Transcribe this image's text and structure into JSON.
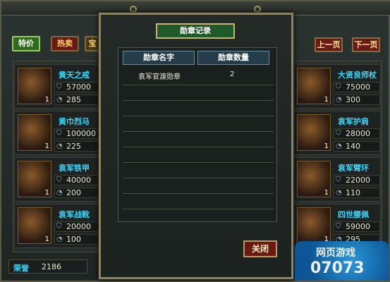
{
  "shop": {
    "tabs": [
      "特价",
      "热卖",
      "宝"
    ],
    "prev_page": "上一页",
    "next_page": "下一页",
    "honor_label": "荣誉",
    "honor_value": "2186",
    "left_items": [
      {
        "name": "黄天之戒",
        "qty": "1",
        "price": "57000",
        "value": "285"
      },
      {
        "name": "黄巾烈马",
        "qty": "1",
        "price": "100000",
        "value": "225"
      },
      {
        "name": "袁军铁甲",
        "qty": "1",
        "price": "40000",
        "value": "200"
      },
      {
        "name": "袁军战靴",
        "qty": "1",
        "price": "20000",
        "value": "100"
      }
    ],
    "right_items": [
      {
        "name": "大贤良师杖",
        "qty": "1",
        "price": "75000",
        "value": "300"
      },
      {
        "name": "袁军护肩",
        "qty": "1",
        "price": "28000",
        "value": "140"
      },
      {
        "name": "袁军臂环",
        "qty": "1",
        "price": "22000",
        "value": "110"
      },
      {
        "name": "四世腰佩",
        "qty": "1",
        "price": "59000",
        "value": "295"
      }
    ]
  },
  "modal": {
    "title": "勋章记录",
    "col_name": "勋章名字",
    "col_count": "勋章数量",
    "rows": [
      {
        "name": "袁军官渡勋章",
        "count": "2"
      }
    ],
    "close": "关闭"
  },
  "watermark": {
    "line1": "网页游戏",
    "line2": "07073"
  },
  "colors": {
    "item_name": "#34d8ff",
    "button_red": "#6a1a12",
    "title_green": "#1e5a2a"
  }
}
